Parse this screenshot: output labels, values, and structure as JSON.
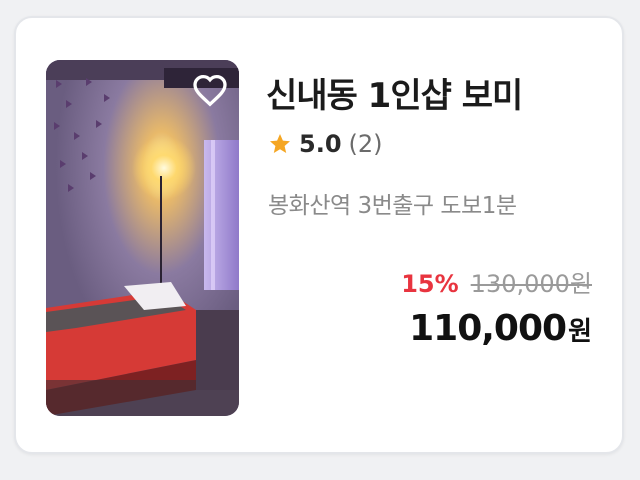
{
  "product": {
    "title": "신내동 1인샵 보미",
    "rating": {
      "icon": "star-icon",
      "star_color": "#f5a623",
      "score": "5.0",
      "count": "(2)"
    },
    "location": "봉화산역 3번출구 도보1분",
    "pricing": {
      "discount_rate": "15%",
      "discount_color": "#e8343f",
      "original_price": "130,000원",
      "sale_price": "110,000",
      "currency": "원"
    },
    "image": {
      "alt": "massage room photo",
      "favorite_icon": "heart-outline-icon"
    }
  }
}
